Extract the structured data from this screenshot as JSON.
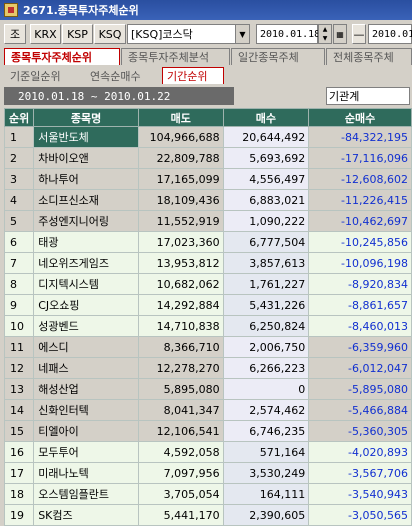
{
  "window": {
    "title": "2671.종목투자주체순위"
  },
  "toolbar": {
    "button1": "조",
    "market_krx": "KRX",
    "market_ksp": "KSP",
    "market_ksq": "KSQ",
    "market_select": "[KSQ]코스닥",
    "date_from": "2010.01.18",
    "separator": "—",
    "date_to": "2010.01"
  },
  "tabs": [
    {
      "label": "종목투자주체순위",
      "active": true
    },
    {
      "label": "종목투자주체분석",
      "active": false
    },
    {
      "label": "일간종목주체",
      "active": false
    },
    {
      "label": "전체종목주체",
      "active": false
    }
  ],
  "subtabs": [
    {
      "label": "기준일순위",
      "active": false
    },
    {
      "label": "연속순매수",
      "active": false
    },
    {
      "label": "기간순위",
      "active": true
    }
  ],
  "period": "2010.01.18 ~ 2010.01.22",
  "investor": "기관계",
  "table": {
    "headers": [
      "순위",
      "종목명",
      "매도",
      "매수",
      "순매수"
    ],
    "rows": [
      {
        "rank": "1",
        "name": "서울반도체",
        "sell": "104,966,688",
        "buy": "20,644,492",
        "net": "-84,322,195"
      },
      {
        "rank": "2",
        "name": "차바이오앤",
        "sell": "22,809,788",
        "buy": "5,693,692",
        "net": "-17,116,096"
      },
      {
        "rank": "3",
        "name": "하나투어",
        "sell": "17,165,099",
        "buy": "4,556,497",
        "net": "-12,608,602"
      },
      {
        "rank": "4",
        "name": "소디프신소재",
        "sell": "18,109,436",
        "buy": "6,883,021",
        "net": "-11,226,415"
      },
      {
        "rank": "5",
        "name": "주성엔지니어링",
        "sell": "11,552,919",
        "buy": "1,090,222",
        "net": "-10,462,697"
      },
      {
        "rank": "6",
        "name": "태광",
        "sell": "17,023,360",
        "buy": "6,777,504",
        "net": "-10,245,856"
      },
      {
        "rank": "7",
        "name": "네오위즈게임즈",
        "sell": "13,953,812",
        "buy": "3,857,613",
        "net": "-10,096,198"
      },
      {
        "rank": "8",
        "name": "디지텍시스템",
        "sell": "10,682,062",
        "buy": "1,761,227",
        "net": "-8,920,834"
      },
      {
        "rank": "9",
        "name": "CJ오쇼핑",
        "sell": "14,292,884",
        "buy": "5,431,226",
        "net": "-8,861,657"
      },
      {
        "rank": "10",
        "name": "성광벤드",
        "sell": "14,710,838",
        "buy": "6,250,824",
        "net": "-8,460,013"
      },
      {
        "rank": "11",
        "name": "에스디",
        "sell": "8,366,710",
        "buy": "2,006,750",
        "net": "-6,359,960"
      },
      {
        "rank": "12",
        "name": "네패스",
        "sell": "12,278,270",
        "buy": "6,266,223",
        "net": "-6,012,047"
      },
      {
        "rank": "13",
        "name": "해성산업",
        "sell": "5,895,080",
        "buy": "0",
        "net": "-5,895,080"
      },
      {
        "rank": "14",
        "name": "신화인터텍",
        "sell": "8,041,347",
        "buy": "2,574,462",
        "net": "-5,466,884"
      },
      {
        "rank": "15",
        "name": "티엘아이",
        "sell": "12,106,541",
        "buy": "6,746,235",
        "net": "-5,360,305"
      },
      {
        "rank": "16",
        "name": "모두투어",
        "sell": "4,592,058",
        "buy": "571,164",
        "net": "-4,020,893"
      },
      {
        "rank": "17",
        "name": "미래나노텍",
        "sell": "7,097,956",
        "buy": "3,530,249",
        "net": "-3,567,706"
      },
      {
        "rank": "18",
        "name": "오스템임플란트",
        "sell": "3,705,054",
        "buy": "164,111",
        "net": "-3,540,943"
      },
      {
        "rank": "19",
        "name": "SK컴즈",
        "sell": "5,441,170",
        "buy": "2,390,605",
        "net": "-3,050,565"
      }
    ]
  },
  "colors": {
    "header_bg": "#2f6b5c",
    "negative": "#1230d0",
    "active_tab": "#c00000"
  }
}
